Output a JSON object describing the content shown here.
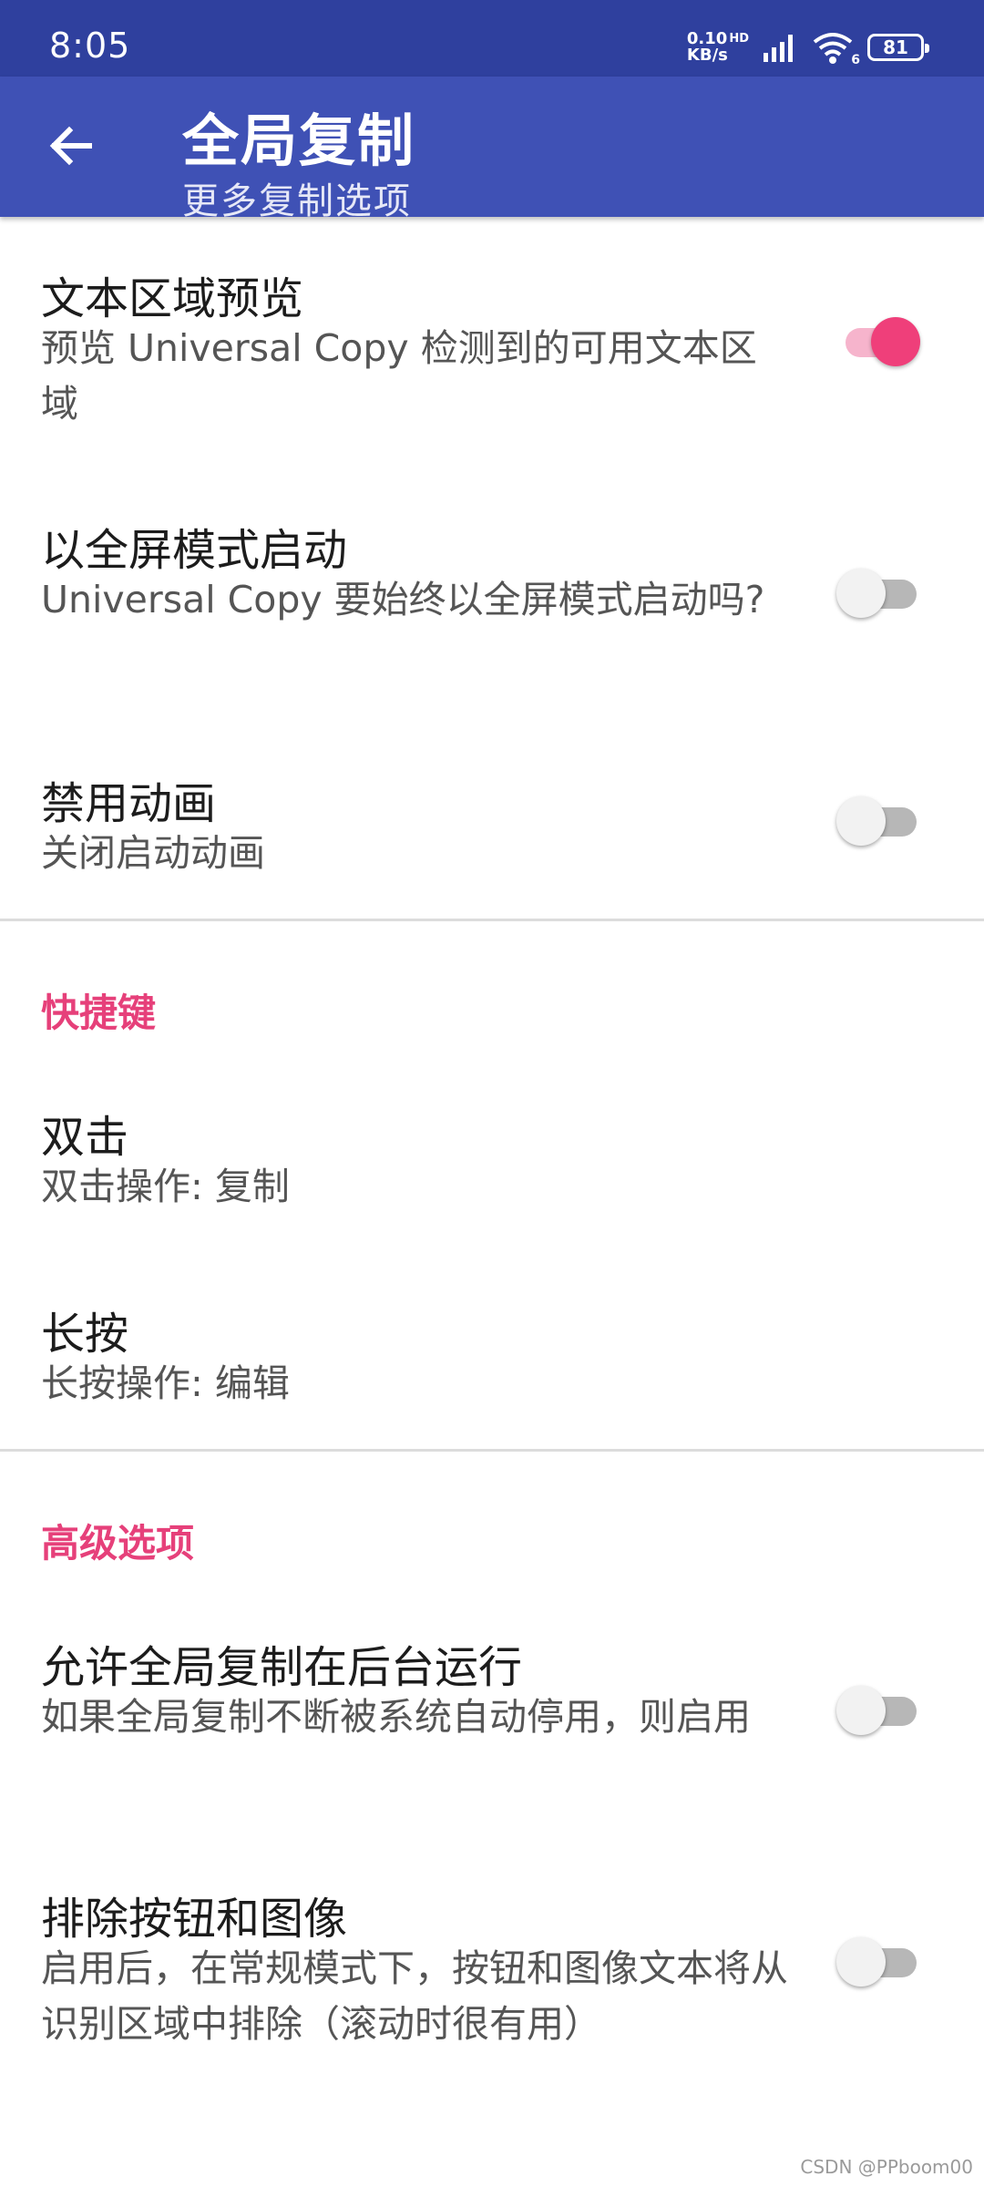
{
  "status_bar": {
    "time": "8:05",
    "net_speed": "0.10",
    "net_unit": "KB/s",
    "hd": "HD",
    "wifi_badge": "6",
    "battery": "81"
  },
  "app_bar": {
    "title": "全局复制",
    "subtitle": "更多复制选项"
  },
  "settings": [
    {
      "title": "文本区域预览",
      "subtitle": "预览 Universal Copy 检测到的可用文本区域",
      "toggle": true
    },
    {
      "title": "以全屏模式启动",
      "subtitle": "Universal Copy 要始终以全屏模式启动吗?",
      "toggle": false
    },
    {
      "title": "禁用动画",
      "subtitle": "关闭启动动画",
      "toggle": false
    }
  ],
  "shortcuts": {
    "header": "快捷键",
    "items": [
      {
        "title": "双击",
        "subtitle": "双击操作: 复制"
      },
      {
        "title": "长按",
        "subtitle": "长按操作: 编辑"
      }
    ]
  },
  "advanced": {
    "header": "高级选项",
    "items": [
      {
        "title": "允许全局复制在后台运行",
        "subtitle": "如果全局复制不断被系统自动停用，则启用",
        "toggle": false
      },
      {
        "title": "排除按钮和图像",
        "subtitle": "启用后，在常规模式下，按钮和图像文本将从识别区域中排除（滚动时很有用）",
        "toggle": false
      }
    ]
  },
  "watermark": "CSDN @PPboom00",
  "colors": {
    "status_bar": "#2f409e",
    "app_bar": "#3f51b5",
    "accent": "#e6407a",
    "switch_on": "#ef3f7a"
  }
}
